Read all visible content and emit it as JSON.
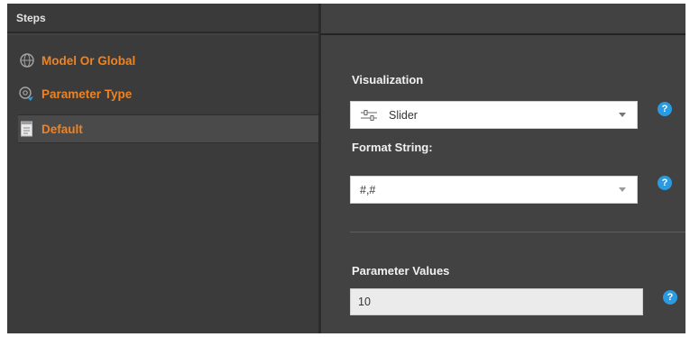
{
  "header": {
    "steps_title": "Steps"
  },
  "steps": [
    {
      "label": "Model Or Global",
      "icon": "globe-icon",
      "selected": false
    },
    {
      "label": "Parameter Type",
      "icon": "parameter-type-icon",
      "selected": false
    },
    {
      "label": "Default",
      "icon": "document-icon",
      "selected": true
    }
  ],
  "form": {
    "visualization": {
      "label": "Visualization",
      "value": "Slider",
      "icon": "slider-icon"
    },
    "format_string": {
      "label": "Format String:",
      "value": "#,#"
    },
    "parameter_values": {
      "label": "Parameter Values",
      "value": "10"
    },
    "help_glyph": "?"
  },
  "colors": {
    "accent_orange": "#f08321",
    "help_blue": "#2a9be0",
    "panel_dark": "#3b3b3b",
    "panel": "#424242"
  }
}
